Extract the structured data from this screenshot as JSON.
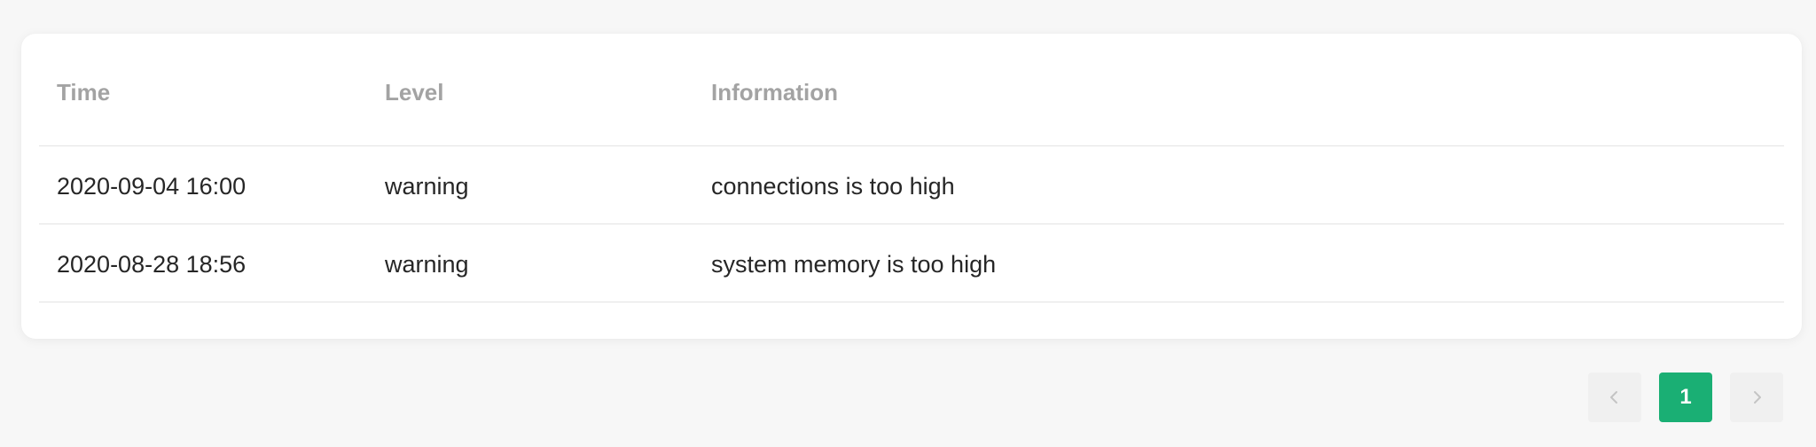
{
  "table": {
    "columns": {
      "time": "Time",
      "level": "Level",
      "information": "Information"
    },
    "rows": [
      {
        "time": "2020-09-04 16:00",
        "level": "warning",
        "information": "connections is too high"
      },
      {
        "time": "2020-08-28 18:56",
        "level": "warning",
        "information": "system memory is too high"
      }
    ]
  },
  "pagination": {
    "prev_icon": "chevron-left-icon",
    "next_icon": "chevron-right-icon",
    "current_page": "1",
    "accent_color": "#1aaf74"
  }
}
